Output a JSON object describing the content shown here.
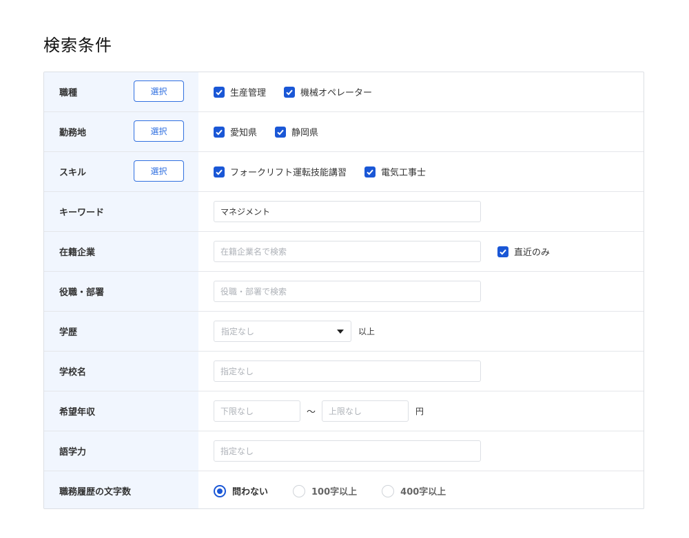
{
  "page_title": "検索条件",
  "colors": {
    "accent": "#1a57d6",
    "label_bg": "#f1f6fe",
    "border": "#dcdfe4"
  },
  "select_button_label": "選択",
  "rows": {
    "job_type": {
      "label": "職種",
      "checks": [
        "生産管理",
        "機械オペレーター"
      ]
    },
    "work_location": {
      "label": "勤務地",
      "checks": [
        "愛知県",
        "静岡県"
      ]
    },
    "skill": {
      "label": "スキル",
      "checks": [
        "フォークリフト運転技能講習",
        "電気工事士"
      ]
    },
    "keyword": {
      "label": "キーワード",
      "value": "マネジメント"
    },
    "company": {
      "label": "在籍企業",
      "placeholder": "在籍企業名で検索",
      "recent_label": "直近のみ",
      "recent_checked": true
    },
    "position": {
      "label": "役職・部署",
      "placeholder": "役職・部署で検索"
    },
    "education": {
      "label": "学歴",
      "selected": "指定なし",
      "suffix": "以上"
    },
    "school": {
      "label": "学校名",
      "placeholder": "指定なし"
    },
    "salary": {
      "label": "希望年収",
      "min_placeholder": "下限なし",
      "separator": "〜",
      "max_placeholder": "上限なし",
      "unit": "円"
    },
    "language": {
      "label": "語学力",
      "placeholder": "指定なし"
    },
    "resume_length": {
      "label": "職務履歴の文字数",
      "options": [
        "問わない",
        "100字以上",
        "400字以上"
      ],
      "selected_index": 0
    }
  }
}
